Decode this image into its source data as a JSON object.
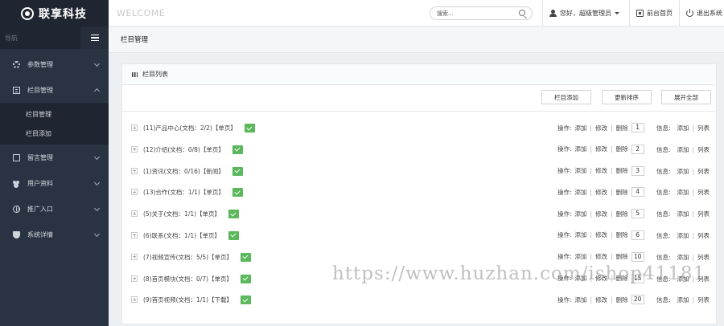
{
  "header": {
    "brand": "联享科技",
    "welcome": "WELCOME",
    "search_placeholder": "搜索...",
    "user_greeting": "您好，超级管理员",
    "frontend_link": "前台首页",
    "logout_link": "退出系统"
  },
  "sidebar": {
    "nav_label": "导航",
    "items": [
      {
        "label": "参数管理",
        "icon": "gear-icon"
      },
      {
        "label": "栏目管理",
        "icon": "list-icon",
        "open": true,
        "subitems": [
          "栏目管理",
          "栏目添加"
        ]
      },
      {
        "label": "留言管理",
        "icon": "message-icon"
      },
      {
        "label": "用户资料",
        "icon": "users-icon"
      },
      {
        "label": "推广入口",
        "icon": "globe-icon"
      },
      {
        "label": "系统详情",
        "icon": "shield-icon"
      }
    ]
  },
  "page": {
    "title": "栏目管理",
    "panel_title": "栏目列表",
    "buttons": {
      "add": "栏目添加",
      "update_order": "更新排序",
      "expand_all": "展开全部"
    },
    "ops_label": "操作:",
    "info_label": "信息:",
    "op_add": "添加",
    "op_edit": "修改",
    "op_delete": "删除",
    "info_add": "添加",
    "info_list": "列表",
    "rows": [
      {
        "label": "(11)产品中心(文档：2/2)【单页】",
        "order": "1"
      },
      {
        "label": "(12)介绍(文档：0/8)【单页】",
        "order": "2"
      },
      {
        "label": "(1)资讯(文档：0/16)【新闻】",
        "order": "3"
      },
      {
        "label": "(13)合作(文档：1/1)【单页】",
        "order": "4"
      },
      {
        "label": "(5)关于(文档：1/1)【单页】",
        "order": "5"
      },
      {
        "label": "(6)联系(文档：1/1)【单页】",
        "order": "6"
      },
      {
        "label": "(7)视频宣传(文档：5/5)【单页】",
        "order": "10"
      },
      {
        "label": "(8)首页模块(文档：0/7)【单页】",
        "order": "15"
      },
      {
        "label": "(9)首页视频(文档：1/1)【下载】",
        "order": "20"
      }
    ]
  },
  "watermark": "https://www.huzhan.com/ishop41181"
}
